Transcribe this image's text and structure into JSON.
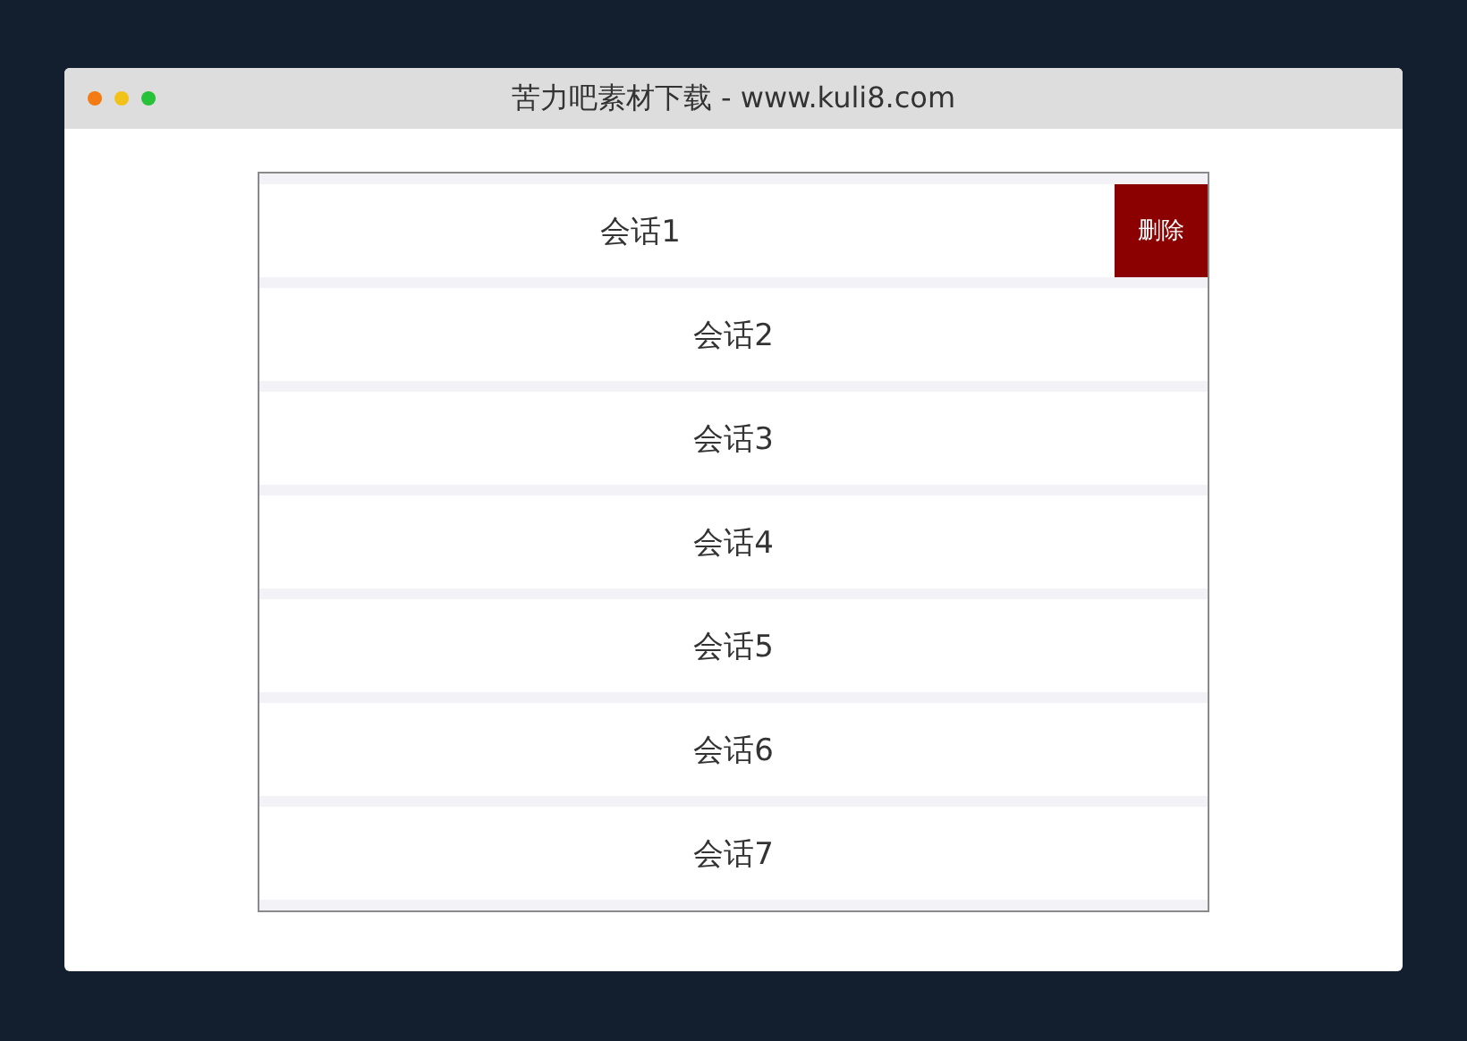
{
  "window": {
    "title": "苦力吧素材下载 - www.kuli8.com"
  },
  "delete_label": "删除",
  "sessions": [
    {
      "label": "会话1",
      "swiped": true
    },
    {
      "label": "会话2",
      "swiped": false
    },
    {
      "label": "会话3",
      "swiped": false
    },
    {
      "label": "会话4",
      "swiped": false
    },
    {
      "label": "会话5",
      "swiped": false
    },
    {
      "label": "会话6",
      "swiped": false
    },
    {
      "label": "会话7",
      "swiped": false
    }
  ]
}
